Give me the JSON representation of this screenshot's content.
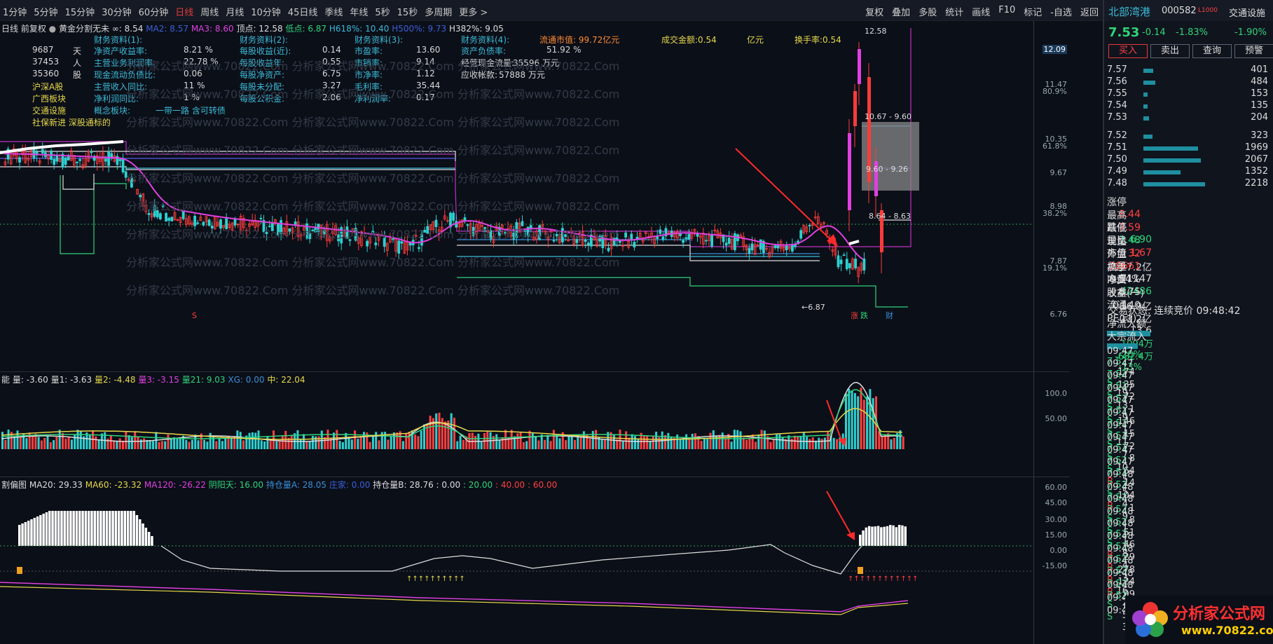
{
  "toolbar": {
    "periods": [
      "1分钟",
      "5分钟",
      "15分钟",
      "30分钟",
      "60分钟",
      "日线",
      "周线",
      "月线",
      "10分钟",
      "45日线",
      "季线",
      "年线",
      "5秒",
      "15秒",
      "多周期",
      "更多 >"
    ],
    "active": "日线",
    "tools": [
      "复权",
      "叠加",
      "多股",
      "统计",
      "画线",
      "F10",
      "标记",
      "-自选",
      "返回"
    ]
  },
  "main_title": {
    "mode": "日线 前复权",
    "indicator": "黄金分割无未",
    "ma1": "∞: 8.54",
    "ma2": "MA2: 8.57",
    "ma3": "MA3: 8.60",
    "high": "顶点: 12.58",
    "low": "低点: 6.87",
    "h618": "H618%: 10.40",
    "h500": "H500%: 9.73",
    "h382": "H382%: 9.05"
  },
  "fin": {
    "col1": [
      [
        "9687",
        "天"
      ],
      [
        "37453",
        "人"
      ],
      [
        "35360",
        "股"
      ],
      [
        "沪深A股",
        ""
      ],
      [
        "广西板块",
        ""
      ],
      [
        "交通设施",
        ""
      ],
      [
        "社保新进 深股通标的",
        ""
      ]
    ],
    "h1": "财务资料(1):",
    "c1": [
      [
        "净资产收益率:",
        "8.21 %"
      ],
      [
        "主营业务利润率:",
        "22.78 %"
      ],
      [
        "现金流动负债比:",
        "0.06"
      ],
      [
        "主营收入同比:",
        "11 %"
      ],
      [
        "净利润同比:",
        "1 %"
      ],
      [
        "概念板块:",
        "一带一路 含可转债"
      ]
    ],
    "h2": "财务资料(2):",
    "c2": [
      [
        "每股收益(近):",
        "0.14"
      ],
      [
        "每股收益年:",
        "0.55"
      ],
      [
        "每股净资产:",
        "6.75"
      ],
      [
        "每股未分配:",
        "3.27"
      ],
      [
        "每股公积金:",
        "2.06"
      ]
    ],
    "h3": "财务资料(3):",
    "c3": [
      [
        "市盈率:",
        "13.60"
      ],
      [
        "市销率:",
        "9.14"
      ],
      [
        "市净率:",
        "1.12"
      ],
      [
        "毛利率:",
        "35.44"
      ],
      [
        "净利润率:",
        "0.17"
      ]
    ],
    "h4": "财务资料(4):",
    "c4": [
      [
        "资产负债率:",
        "51.92 %"
      ],
      [
        "经营现金流量:",
        "35596 万元"
      ],
      [
        "应收帐款:",
        "57888 万元"
      ]
    ],
    "mktcap": "流通市值: 99.72亿元",
    "turnover_amt": "成交金额:0.54",
    "yi": "亿元",
    "turnover_rate": "换手率:0.54"
  },
  "main_y": [
    "12.09",
    "11.47",
    "80.9%",
    "10.35",
    "61.8%",
    "9.67",
    "8.98",
    "38.2%",
    "7.87",
    "19.1%",
    "6.76"
  ],
  "main_notes": [
    "12.58",
    "10.67 - 9.60",
    "9.60 - 9.26",
    "8.64 - 8.63",
    "6.87",
    "涨",
    "跌",
    "财",
    "S"
  ],
  "ind_title": {
    "name": "能",
    "l0": "量: -3.60",
    "l1": "量1: -3.63",
    "l2": "量2: -4.48",
    "l3": "量3: -3.15",
    "l21": "量21: 9.03",
    "xg": "XG: 0.00",
    "mid": "中: 22.04"
  },
  "ind_y": [
    "100.0",
    "50.00"
  ],
  "low_title": {
    "name": "割偏图",
    "ma20": "MA20: 29.33",
    "ma60": "MA60: -23.32",
    "ma120": "MA120: -26.22",
    "yy": "阴阳天: 16.00",
    "cca": "持仓量A: 28.05",
    "zz": "庄家: 0.00",
    "ccb": "持仓量B: 28.76 : 0.00",
    "v20": ": 20.00",
    "v40": ": 40.00",
    "v60": ": 60.00"
  },
  "low_y": [
    "60.00",
    "45.00",
    "30.00",
    "15.00",
    "0.00",
    "-15.00"
  ],
  "right": {
    "name": "北部湾港",
    "code": "000582",
    "tag": "L1000",
    "sector": "交通设施",
    "price": "7.53",
    "chg": "-0.14",
    "pct": "-1.83%",
    "pct2": "-1.90%",
    "buttons": [
      "买入",
      "卖出",
      "查询",
      "预警"
    ],
    "asks": [
      {
        "p": "7.57",
        "v": "401",
        "w": 0.12
      },
      {
        "p": "7.56",
        "v": "484",
        "w": 0.14
      },
      {
        "p": "7.55",
        "v": "153",
        "w": 0.05
      },
      {
        "p": "7.54",
        "v": "135",
        "w": 0.05
      },
      {
        "p": "7.53",
        "v": "204",
        "w": 0.07
      }
    ],
    "bids": [
      {
        "p": "7.52",
        "v": "323",
        "w": 0.1
      },
      {
        "p": "7.51",
        "v": "1969",
        "w": 0.6
      },
      {
        "p": "7.50",
        "v": "2067",
        "w": 0.63
      },
      {
        "p": "7.49",
        "v": "1352",
        "w": 0.41
      },
      {
        "p": "7.48",
        "v": "2218",
        "w": 0.68
      }
    ],
    "stats": [
      [
        "涨停",
        "8.44",
        "跌停",
        "6.90"
      ],
      [
        "最高",
        "7.59",
        "量比",
        "1.67"
      ],
      [
        "最低",
        "7.48",
        "市值",
        "127.2亿"
      ],
      [
        "现量",
        "32",
        "总量",
        "71147"
      ],
      [
        "外盘",
        "28661",
        "内盘",
        "42486"
      ],
      [
        "换手",
        "0.54%",
        "股本",
        "16.9亿"
      ],
      [
        "净资",
        "6.75",
        "流通",
        "13.2亿"
      ],
      [
        "收益(一)",
        "0.140",
        "PE(动)",
        "13.6"
      ]
    ],
    "trade_status": "交易状态: 连续竞价 09:48:42",
    "netflow": [
      "净流入额",
      "-1094万",
      "-20%"
    ],
    "bigflow": [
      "大宗流入",
      "-682.4万",
      "-13%"
    ],
    "ticks": [
      [
        "09:47",
        "7.52",
        "174",
        "S",
        "19"
      ],
      [
        "09:47",
        "7.52",
        "135",
        "S",
        "13"
      ],
      [
        "09:47",
        "7.51",
        "72",
        "S",
        "9"
      ],
      [
        "09:47",
        "7.51",
        "1",
        "S",
        "1"
      ],
      [
        "09:47",
        "7.51",
        "146",
        "S",
        "11"
      ],
      [
        "09:47",
        "7.51",
        "15",
        "S",
        "7"
      ],
      [
        "09:47",
        "7.51",
        "72",
        "S",
        "10"
      ],
      [
        "09:47",
        "7.51",
        "8",
        "S",
        "5"
      ],
      [
        "09:47",
        "7.52",
        "64",
        "B",
        "5"
      ],
      [
        "09:47",
        "7.51",
        "14",
        "S",
        "4"
      ],
      [
        "09:48",
        "7.52",
        "104",
        "B",
        "9"
      ],
      [
        "09:48",
        "7.52",
        "1",
        "S",
        "1"
      ],
      [
        "09:48",
        "7.52",
        "8",
        "S",
        "1"
      ],
      [
        "09:48",
        "7.52",
        "51",
        "S",
        "8"
      ],
      [
        "09:48",
        "7.52",
        "46",
        "B",
        "4"
      ],
      [
        "09:48",
        "7.52",
        "29",
        "B",
        "3"
      ],
      [
        "09:48",
        "7.52",
        "278",
        "B",
        "16"
      ],
      [
        "09:48",
        "7.53",
        "124",
        "B",
        "2"
      ],
      [
        "09:48",
        "7.52",
        "99",
        "S",
        "5"
      ],
      [
        "09:48",
        "7.52",
        "81",
        "S",
        "3"
      ],
      [
        "09:4",
        "",
        "",
        "",
        ""
      ],
      [
        "09:4",
        "",
        "",
        "",
        ""
      ]
    ]
  },
  "watermark": {
    "site": "分析家公式网",
    "url": "www.70822.com"
  }
}
